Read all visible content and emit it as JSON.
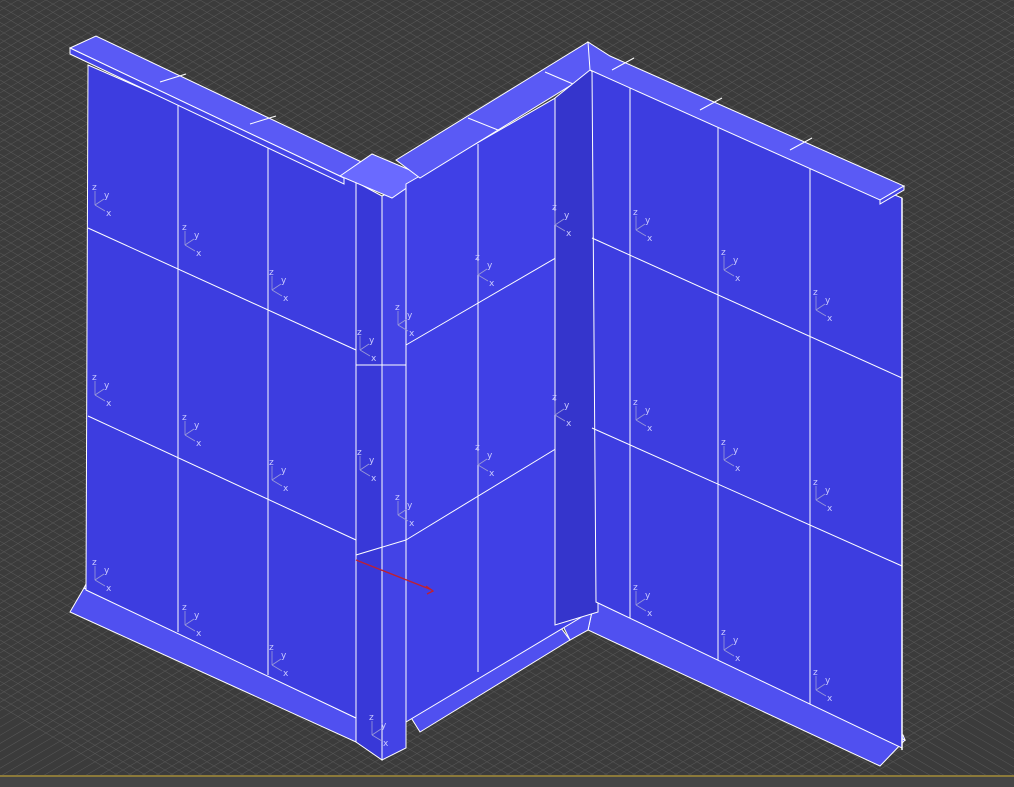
{
  "viewport": {
    "view": "perspective",
    "background_color": "#3b3b3b",
    "grid_color": "#555555",
    "grid_enabled": true,
    "wall_color": "#3d3de0",
    "wall_top_color": "#5252f2",
    "edge_color": "#ffffff",
    "gizmo_x_color": "#c02030"
  },
  "gizmo_axes": [
    "z",
    "y",
    "x"
  ]
}
